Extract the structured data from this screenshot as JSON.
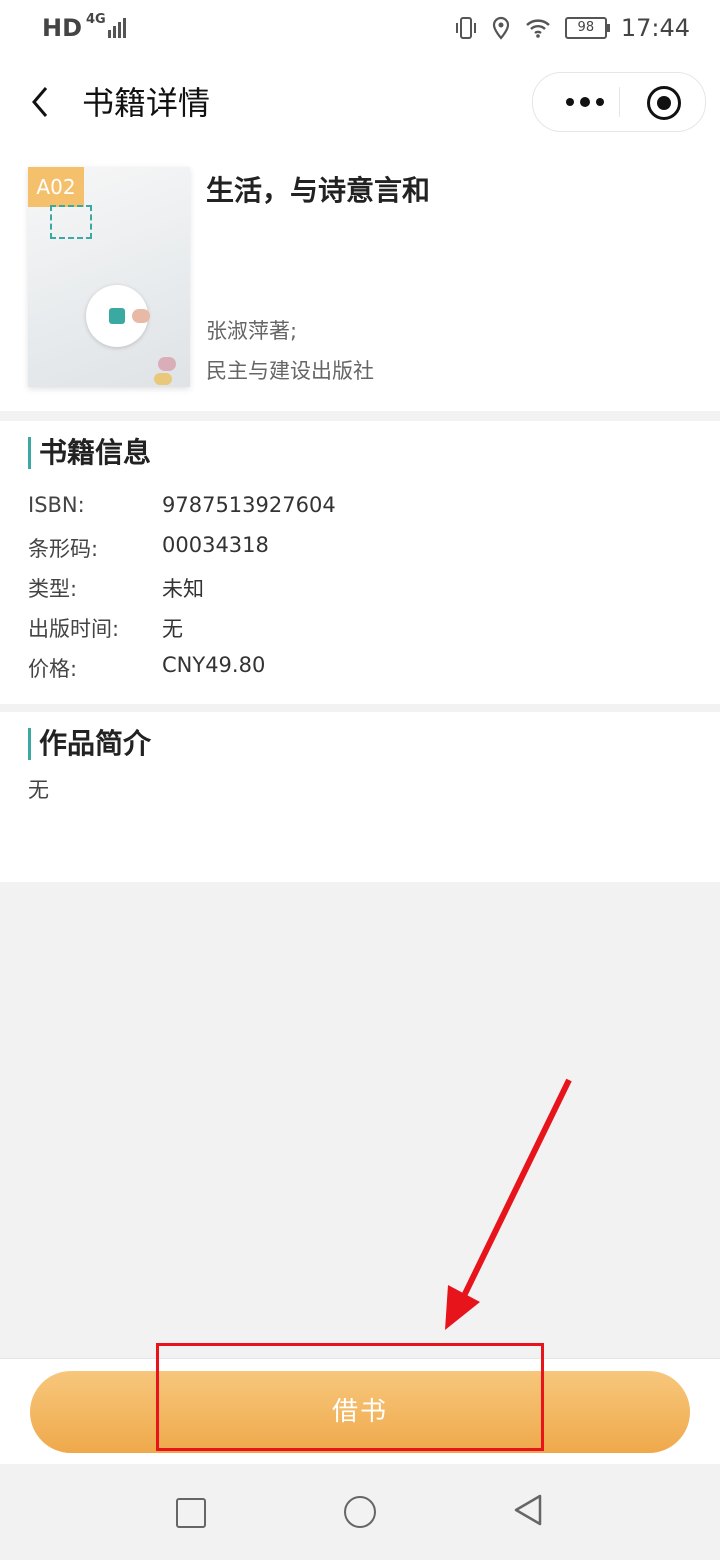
{
  "status_bar": {
    "left": "HD",
    "network": "4G",
    "battery": "98",
    "time": "17:44"
  },
  "header": {
    "title": "书籍详情"
  },
  "book": {
    "cover_tag": "A02",
    "title": "生活，与诗意言和",
    "author": "张淑萍著;",
    "publisher": "民主与建设出版社"
  },
  "info": {
    "section_title": "书籍信息",
    "rows": [
      {
        "label": "ISBN:",
        "value": "9787513927604"
      },
      {
        "label": "条形码:",
        "value": "00034318"
      },
      {
        "label": "类型:",
        "value": "未知"
      },
      {
        "label": "出版时间:",
        "value": "无"
      },
      {
        "label": "价格:",
        "value": "CNY49.80"
      }
    ]
  },
  "intro": {
    "section_title": "作品简介",
    "text": "无"
  },
  "actions": {
    "borrow_label": "借书"
  },
  "colors": {
    "accent": "#3aa9a1",
    "button_start": "#f7c77c",
    "button_end": "#efa94b",
    "annotation": "#e8141b"
  },
  "icons": [
    "back-icon",
    "more-icon",
    "close-mini-program-icon",
    "vibrate-icon",
    "location-icon",
    "wifi-icon",
    "battery-icon",
    "nav-recent-icon",
    "nav-home-icon",
    "nav-back-icon"
  ]
}
